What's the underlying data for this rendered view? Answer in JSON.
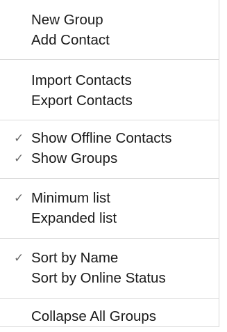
{
  "menu": {
    "groups": [
      {
        "items": [
          {
            "label": "New Group",
            "checked": false
          },
          {
            "label": "Add Contact",
            "checked": false
          }
        ]
      },
      {
        "items": [
          {
            "label": "Import Contacts",
            "checked": false
          },
          {
            "label": "Export Contacts",
            "checked": false
          }
        ]
      },
      {
        "items": [
          {
            "label": "Show Offline Contacts",
            "checked": true
          },
          {
            "label": "Show Groups",
            "checked": true
          }
        ]
      },
      {
        "items": [
          {
            "label": "Minimum list",
            "checked": true
          },
          {
            "label": "Expanded list",
            "checked": false
          }
        ]
      },
      {
        "items": [
          {
            "label": "Sort by Name",
            "checked": true
          },
          {
            "label": "Sort by Online Status",
            "checked": false
          }
        ]
      },
      {
        "items": [
          {
            "label": "Collapse All Groups",
            "checked": false
          }
        ]
      }
    ],
    "check_glyph": "✓",
    "check_icon": "checkmark-icon",
    "colors": {
      "text": "#1a1a1a",
      "check": "#6a6a6a",
      "separator": "#dcdcdc",
      "background": "#ffffff"
    }
  }
}
